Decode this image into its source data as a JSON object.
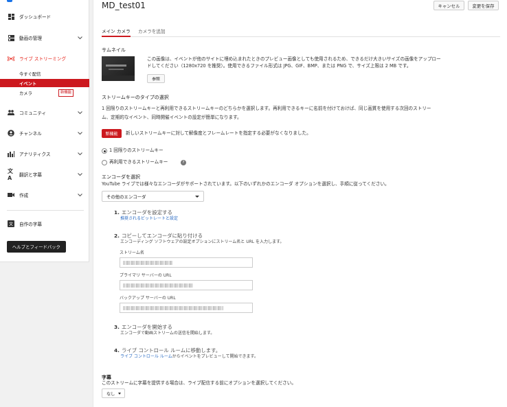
{
  "sidebar": {
    "items": [
      {
        "label": "ダッシュボード"
      },
      {
        "label": "動画の管理"
      },
      {
        "label": "ライブ ストリーミング"
      },
      {
        "label": "コミュニティ"
      },
      {
        "label": "チャンネル"
      },
      {
        "label": "アナリティクス"
      },
      {
        "label": "翻訳と字幕"
      },
      {
        "label": "作成"
      },
      {
        "label": "自作の字幕"
      }
    ],
    "live_sub": [
      {
        "label": "今すぐ配信"
      },
      {
        "label": "イベント"
      },
      {
        "label": "カメラ",
        "badge": "新機能"
      }
    ],
    "help_button": "ヘルプとフィードバック"
  },
  "header": {
    "title": "MD_test01",
    "cancel": "キャンセル",
    "save": "変更を保存"
  },
  "tabs": [
    "メイン カメラ",
    "カメラを追加"
  ],
  "thumbnail": {
    "heading": "サムネイル",
    "desc1": "この画像は、イベントが他のサイトに埋め込まれたときのプレビュー画像としても使用されるため、できるだけ大きいサイズの画像をアップロー",
    "desc2": "ドしてください（1280x720 を推奨）。使用できるファイル形式は JPG、GIF、BMP、または PNG で、サイズ上限は 2 MB です。",
    "ref_button": "参照"
  },
  "stream_key": {
    "heading": "ストリームキーのタイプの選択",
    "desc1": "1 回限りのストリームキーと再利用できるストリームキーのどちらかを選択します。再利用できるキーに名前を付けておけば、同じ画質を使用する次回のストリー",
    "desc2": "ム、定期的なイベント、同時開催イベントの設定が簡単になります。",
    "new_badge": "新機能",
    "new_text": "新しいストリームキーに対して解像度とフレームレートを指定する必要がなくなりました。",
    "option1": "1 回限りのストリームキー",
    "option2": "再利用できるストリームキー",
    "help_icon": "?"
  },
  "encoder": {
    "heading": "エンコーダを選択",
    "desc": "YouTube ライブでは様々なエンコーダがサポートされています。以下のいずれかのエンコーダ オプションを選択し、手順に従ってください。",
    "select_value": "その他のエンコーダ",
    "steps": [
      {
        "num": "1.",
        "title": "エンコーダを設定する",
        "sub": "推奨されるビットレートと設定",
        "sub_link": true
      },
      {
        "num": "2.",
        "title": "コピーしてエンコーダに貼り付ける",
        "sub": "エンコーディング ソフトウェアの設定オプションにストリーム名と URL を入力します。",
        "sub_link": false
      },
      {
        "num": "3.",
        "title": "エンコーダを開始する",
        "sub": "エンコーダで動画ストリームの送信を開始します。",
        "sub_link": false
      },
      {
        "num": "4.",
        "title": "ライブ コントロール ルームに移動します。",
        "sub_link_text": "ライブ コントロール ルーム",
        "sub_rest": "からイベントをプレビューして開始できます。"
      }
    ],
    "fields": [
      {
        "label": "ストリーム名"
      },
      {
        "label": "プライマリ サーバーの URL"
      },
      {
        "label": "バックアップ サーバーの URL"
      }
    ]
  },
  "captions": {
    "heading": "字幕",
    "desc": "このストリームに字幕を提供する場合は、ライブ配信する前にオプションを選択してください。",
    "select_value": "なし"
  }
}
